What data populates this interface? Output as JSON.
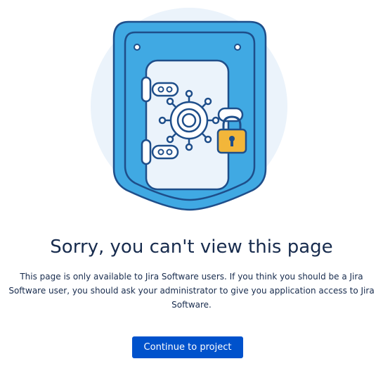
{
  "illustration": {
    "icon": "vault-safe-with-padlock",
    "colors": {
      "background_circle": "#ebf3fb",
      "vault_body": "#40a9e3",
      "vault_outline": "#1e4e8a",
      "door_panel": "#ebf3fb",
      "padlock": "#f2b63a"
    }
  },
  "error": {
    "title": "Sorry, you can't view this page",
    "message": "This page is only available to Jira Software users. If you think you should be a Jira Software user, you should ask your administrator to give you application access to Jira Software."
  },
  "actions": {
    "continue_label": "Continue to project"
  },
  "colors": {
    "primary_button": "#0052cc",
    "text": "#172b4d"
  }
}
